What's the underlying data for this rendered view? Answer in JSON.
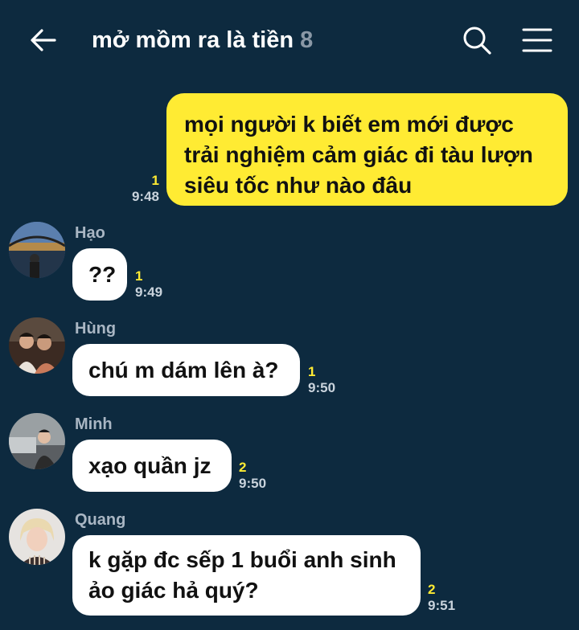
{
  "header": {
    "title": "mở mồm ra là tiền",
    "member_count": "8",
    "icons": {
      "back": "arrow-left-icon",
      "search": "search-icon",
      "menu": "hamburger-menu-icon"
    }
  },
  "colors": {
    "background": "#0d2a3f",
    "outgoing_bubble": "#ffeb33",
    "incoming_bubble": "#ffffff",
    "unread_count": "#ffeb33"
  },
  "messages": [
    {
      "direction": "outgoing",
      "text": "mọi người k biết em mới được trải nghiệm cảm giác đi tàu lượn siêu tốc như nào đâu",
      "unread": "1",
      "time": "9:48"
    },
    {
      "direction": "incoming",
      "sender": "Hạo",
      "text": "??",
      "unread": "1",
      "time": "9:49"
    },
    {
      "direction": "incoming",
      "sender": "Hùng",
      "text": "chú m dám lên à?",
      "unread": "1",
      "time": "9:50"
    },
    {
      "direction": "incoming",
      "sender": "Minh",
      "text": "xạo quần jz",
      "unread": "2",
      "time": "9:50"
    },
    {
      "direction": "incoming",
      "sender": "Quang",
      "text": "k gặp đc sếp 1 buổi anh sinh ảo giác hả quý?",
      "unread": "2",
      "time": "9:51"
    }
  ]
}
